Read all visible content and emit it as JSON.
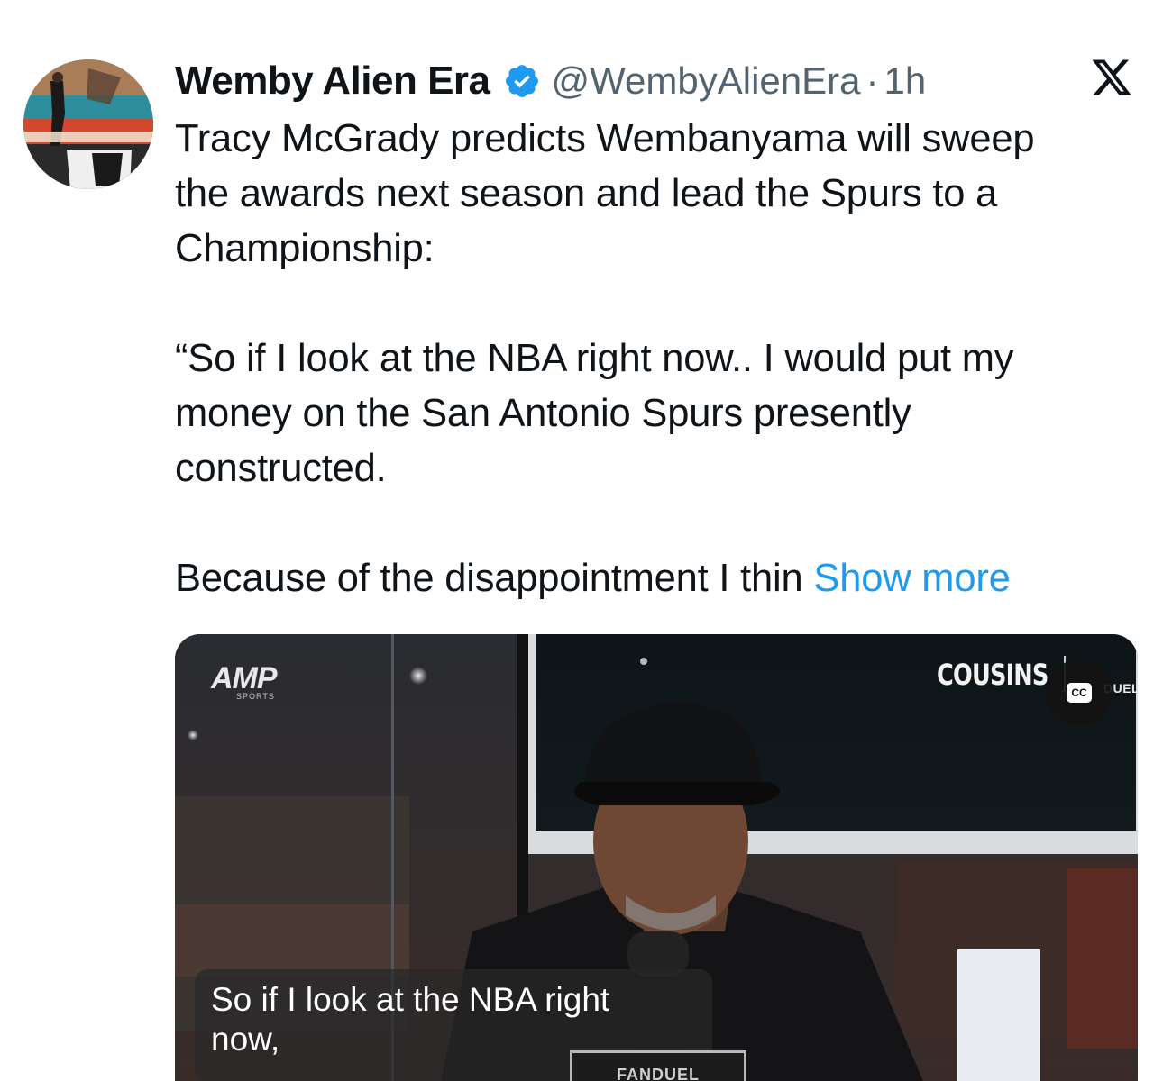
{
  "tweet": {
    "author": {
      "display_name": "Wemby Alien Era",
      "handle": "@WembyAlienEra",
      "separator": "·",
      "time": "1h",
      "verified": true
    },
    "text_lines": [
      "Tracy McGrady predicts Wembanyama will sweep",
      "the awards next season and lead the Spurs to a",
      "Championship:",
      "“So if I look at the NBA right now.. I would put my",
      "money on the San Antonio Spurs presently",
      "constructed.",
      "Because of the disappointment I thin"
    ],
    "show_more_label": "Show more",
    "media": {
      "type": "video",
      "logos": {
        "amp": "AMP",
        "amp_sub": "SPORTS",
        "cousins": "COUSINS",
        "fanduel_top": "DUEL",
        "fanduel_plate": "FANDUEL"
      },
      "cc_label": "CC",
      "caption_line1": "So if I look at the NBA right",
      "caption_line2": "now,"
    }
  },
  "icons": {
    "verified": "verified-badge-icon",
    "platform": "x-logo-icon",
    "captions": "closed-captions-icon"
  },
  "colors": {
    "text": "#0f1419",
    "secondary": "#536471",
    "link": "#1d9bf0",
    "verified": "#1d9bf0"
  }
}
